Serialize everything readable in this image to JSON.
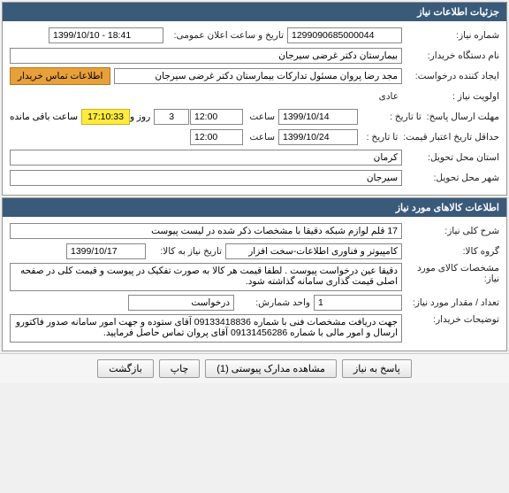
{
  "panel1": {
    "title": "جزئیات اطلاعات نیاز",
    "need_number_label": "شماره نیاز:",
    "need_number": "1299090685000044",
    "announce_label": "تاریخ و ساعت اعلان عمومی:",
    "announce_value": "1399/10/10 - 18:41",
    "buyer_org_label": "نام دستگاه خریدار:",
    "buyer_org": "بیمارستان دکتر غرضی سیرجان",
    "requester_label": "ایجاد کننده درخواست:",
    "requester": "مجد رضا پروان مسئول تدارکات بیمارستان دکتر غرضی سیرجان",
    "contact_btn": "اطلاعات تماس خریدار",
    "priority_label": "اولویت نیاز :",
    "priority": "عادی",
    "deadline_label": "مهلت ارسال پاسخ:",
    "to_date_label": "تا تاریخ :",
    "deadline_date": "1399/10/14",
    "time_label": "ساعت",
    "deadline_time": "12:00",
    "days": "3",
    "days_label": "روز و",
    "remain_time": "17:10:33",
    "remain_label": "ساعت باقی مانده",
    "min_valid_label": "حداقل تاریخ اعتبار قیمت:",
    "to_date_label2": "تا تاریخ :",
    "min_valid_date": "1399/10/24",
    "min_valid_time": "12:00",
    "province_label": "استان محل تحویل:",
    "province": "کرمان",
    "city_label": "شهر محل تحویل:",
    "city": "سیرجان"
  },
  "panel2": {
    "title": "اطلاعات کالاهای مورد نیاز",
    "general_desc_label": "شرح کلی نیاز:",
    "general_desc": "17 قلم لوازم شبکه دقیقا با مشخصات ذکر شده در لیست پیوست",
    "group_label": "گروه کالا:",
    "group": "کامپیوتر و فناوری اطلاعات-سخت افزار",
    "need_date_label": "تاریخ نیاز به کالا:",
    "need_date": "1399/10/17",
    "spec_label": "مشخصات کالای مورد نیاز:",
    "spec": "دقیقا عین درخواست پیوست . لطفا قیمت هر کالا به صورت تفکیک در پیوست و قیمت کلی در صفحه اصلی قیمت گذاری سامانه گذاشته شود.",
    "qty_label": "تعداد / مقدار مورد نیاز:",
    "qty": "1",
    "unit_label": "واحد شمارش:",
    "unit": "درخواست",
    "buyer_note_label": "توضیحات خریدار:",
    "buyer_note": "جهت دریافت مشخصات فنی با شماره 09133418836 آقای ستوده و جهت امور سامانه صدور فاکتورو ارسال و امور مالی با شماره 09131456286 آقای پروان تماس حاصل فرمایید."
  },
  "buttons": {
    "respond": "پاسخ به نیاز",
    "attachments": "مشاهده مدارک پیوستی (1)",
    "print": "چاپ",
    "back": "بازگشت"
  }
}
